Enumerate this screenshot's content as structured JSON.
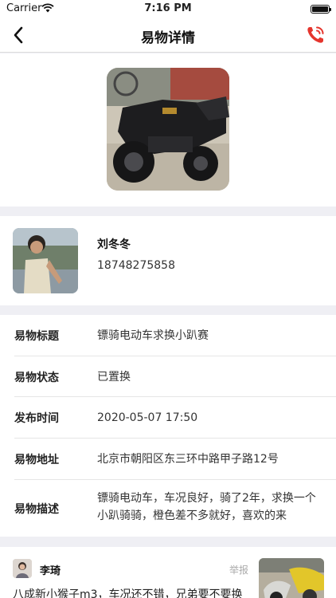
{
  "status_bar": {
    "carrier": "Carrier",
    "time": "7:16 PM"
  },
  "nav": {
    "title": "易物详情",
    "back_icon": "chevron-left-icon",
    "phone_icon": "phone-call-icon",
    "accent_color": "#e5352d"
  },
  "item_photo": {
    "description_icon": "motorcycle-photo"
  },
  "owner": {
    "name": "刘冬冬",
    "phone": "18748275858"
  },
  "details": [
    {
      "label": "易物标题",
      "value": "镖骑电动车求换小趴赛"
    },
    {
      "label": "易物状态",
      "value": "已置换"
    },
    {
      "label": "发布时间",
      "value": "2020-05-07 17:50"
    },
    {
      "label": "易物地址",
      "value": "北京市朝阳区东三环中路甲子路12号"
    },
    {
      "label": "易物描述",
      "value": "镖骑电动车，车况良好，骑了2年，求换一个小趴骑骑，橙色差不多就好，喜欢的来"
    }
  ],
  "comment": {
    "name": "李琦",
    "report_label": "举报",
    "text": "八成新小猴子m3，车况还不错，兄弟要不要换"
  }
}
